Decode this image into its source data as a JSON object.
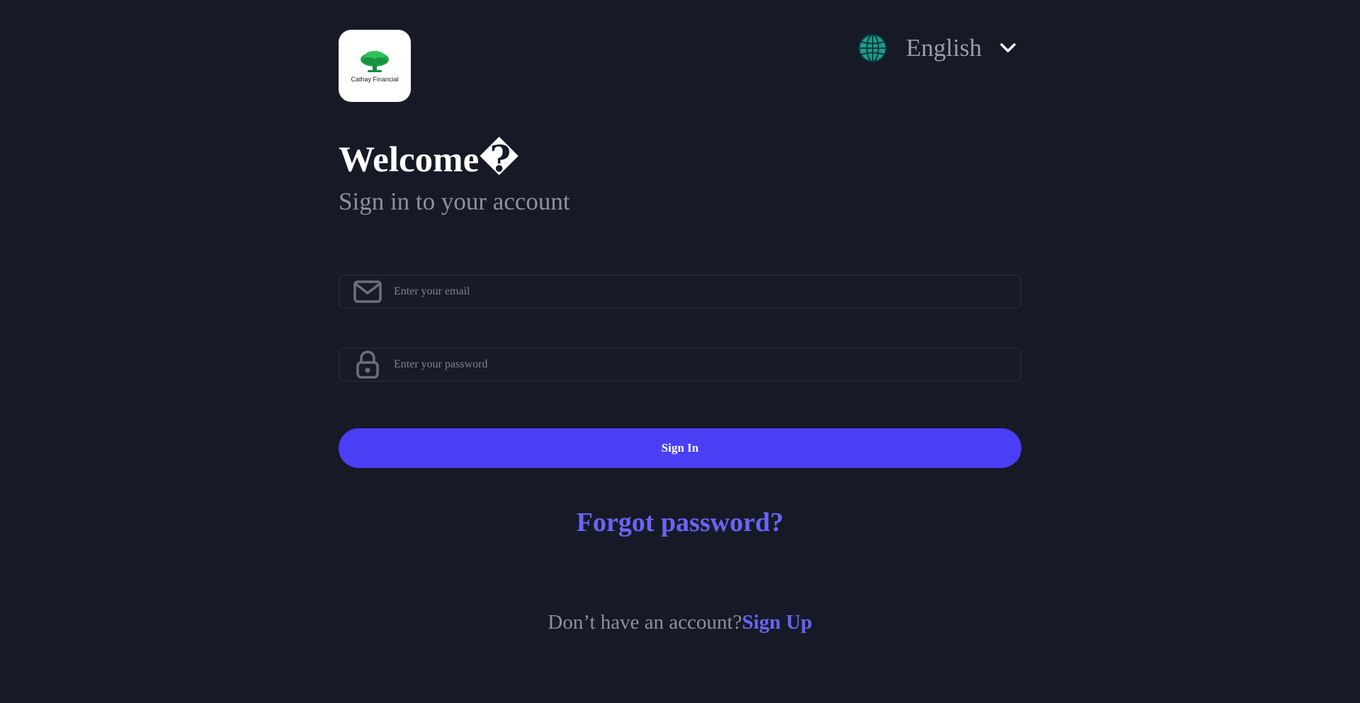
{
  "brand": {
    "name": "Cathay Financial",
    "tree_color": "#1fa84a"
  },
  "language": {
    "selected": "English",
    "icon": "globe-icon",
    "chevron_icon": "chevron-down-icon",
    "globe_color": "#1e9b8c"
  },
  "header": {
    "title": "Welcome�",
    "subtitle": "Sign in to your account"
  },
  "form": {
    "email": {
      "icon": "mail-icon",
      "value": "",
      "placeholder": "Enter your email"
    },
    "password": {
      "icon": "lock-icon",
      "value": "",
      "placeholder": "Enter your password"
    },
    "submit_label": "Sign In"
  },
  "links": {
    "forgot_password": "Forgot password?",
    "signup_prompt": "Don’t have an account?",
    "signup": "Sign Up"
  },
  "colors": {
    "background": "#161a26",
    "accent": "#4a3ff5",
    "link": "#6a63f6"
  }
}
